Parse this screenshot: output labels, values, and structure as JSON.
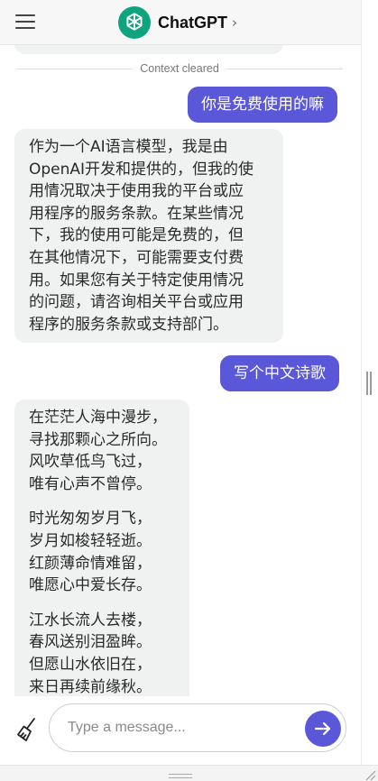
{
  "header": {
    "menu_icon": "hamburger-menu-icon",
    "logo_icon": "openai-logo-icon",
    "title": "ChatGPT",
    "chevron": "›"
  },
  "chat": {
    "divider_label": "Context cleared",
    "messages": [
      {
        "role": "user",
        "text": "你是免费使用的嘛"
      },
      {
        "role": "assistant",
        "lines": [
          "作为一个AI语言模型，我是由",
          "OpenAI开发和提供的，但我的使",
          "用情况取决于使用我的平台或应",
          "用程序的服务条款。在某些情况",
          "下，我的使用可能是免费的，但",
          "在其他情况下，可能需要支付费",
          "用。如果您有关于特定使用情况",
          "的问题，请咨询相关平台或应用",
          "程序的服务条款或支持部门。"
        ]
      },
      {
        "role": "user",
        "text": "写个中文诗歌"
      },
      {
        "role": "assistant",
        "stanzas": [
          [
            "在茫茫人海中漫步，",
            "寻找那颗心之所向。",
            "风吹草低鸟飞过，",
            "唯有心声不曾停。"
          ],
          [
            "时光匆匆岁月飞，",
            "岁月如梭轻轻逝。",
            "红颜薄命情难留，",
            "唯愿心中爱长存。"
          ],
          [
            "江水长流人去楼，",
            "春风送别泪盈眸。",
            "但愿山水依旧在，",
            "来日再续前缘秋。"
          ]
        ]
      }
    ]
  },
  "composer": {
    "placeholder": "Type a message...",
    "value": "",
    "clear_icon": "broom-icon",
    "send_icon": "send-arrow-icon"
  },
  "colors": {
    "accent": "#5b57d9",
    "assistant_bubble": "#f0f1f1",
    "logo": "#10a37f"
  }
}
